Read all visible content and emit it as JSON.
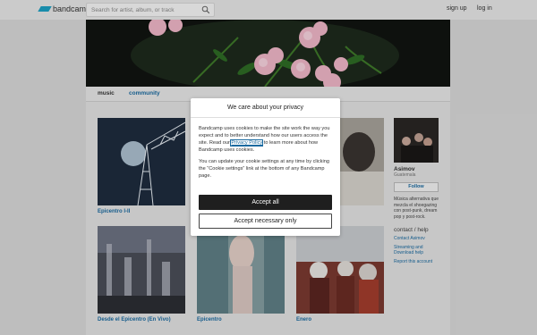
{
  "topbar": {
    "logo_text": "bandcamp",
    "search_placeholder": "Search for artist, album, or track",
    "signup": "sign up",
    "login": "log in"
  },
  "nav": {
    "music": "music",
    "community": "community"
  },
  "albums": [
    {
      "title": "Epicentro I-II"
    },
    {
      "title": ""
    },
    {
      "title": ""
    },
    {
      "title": "Desde el Epicentro (En Vivo)"
    },
    {
      "title": "Epicentro"
    },
    {
      "title": "Enero"
    }
  ],
  "sidebar": {
    "name": "Asimov",
    "location": "Guatemala",
    "follow": "Follow",
    "bio": "Música alternativa que mezcla el shoegazing con post-punk, dream pop y post-rock.",
    "contact_heading": "contact / help",
    "links": [
      "Contact Asimov",
      "Streaming and Download help",
      "Report this account"
    ]
  },
  "cookie": {
    "title": "We care about your privacy",
    "p1_before": "Bandcamp uses cookies to make the site work the way you expect and to better understand how our users access the site. Read our ",
    "privacy_link": "Privacy Policy",
    "p1_after": " to learn more about how Bandcamp uses cookies.",
    "p2": "You can update your cookie settings at any time by clicking the “Cookie settings” link at the bottom of any Bandcamp page.",
    "accept_all": "Accept all",
    "accept_necessary": "Accept necessary only"
  },
  "colors": {
    "accent": "#1da0c3",
    "link": "#1a6aa0"
  }
}
